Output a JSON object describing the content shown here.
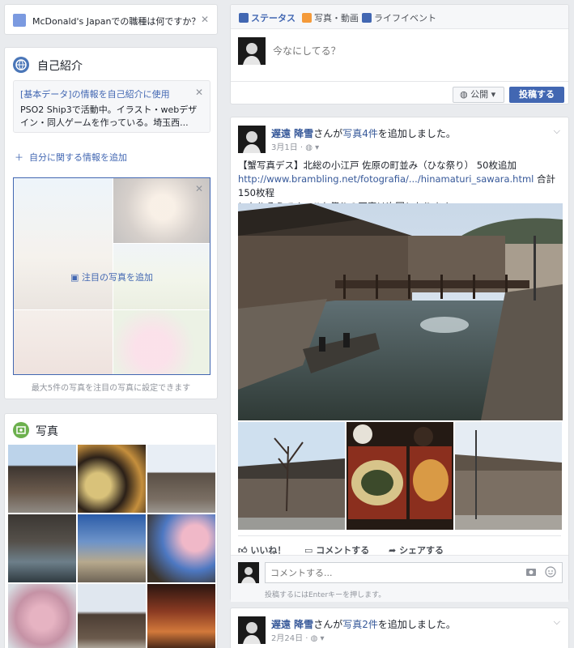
{
  "left": {
    "prompt": {
      "text": "McDonald's Japanでの職種は何ですか？"
    },
    "intro": {
      "title": "自己紹介",
      "notice_link": "[基本データ]の情報を自己紹介に使用",
      "notice_body": "PSO2 Ship3で活動中。イラスト・webデザイン・同人ゲームを作っている。埼玉西...",
      "add_link": "自分に関する情報を追加",
      "featured_label": "注目の写真を追加",
      "featured_note": "最大5件の写真を注目の写真に設定できます"
    },
    "photos": {
      "title": "写真"
    }
  },
  "composer": {
    "tabs": [
      "ステータス",
      "写真・動画",
      "ライフイベント"
    ],
    "placeholder": "今なにしてる？",
    "privacy": "公開",
    "post": "投稿する"
  },
  "post1": {
    "author": "遅遠 降雪",
    "action_pre": "さんが",
    "action_link": "写真4件",
    "action_post": "を追加しました。",
    "date": "3月1日",
    "text_line1": "【蟹写真デス】北総の小江戸 佐原の町並み（ひな祭り） 50枚追加",
    "url": "http://www.brambling.net/fotografia/.../hinamaturi_sawara.html",
    "text_after_url": " 合計150枚程",
    "text_line3": "になりそうです。ひな祭りの写真は次回となります。",
    "like": "いいね！",
    "comment": "コメントする",
    "share": "シェアする",
    "comment_placeholder": "コメントする...",
    "comment_hint": "投稿するにはEnterキーを押します。"
  },
  "post2": {
    "author": "遅遠 降雪",
    "action_pre": "さんが",
    "action_link": "写真2件",
    "action_post": "を追加しました。",
    "date": "2月24日"
  },
  "colors": {
    "accent": "#4267b2",
    "link": "#365899",
    "bg": "#e9ebee"
  }
}
